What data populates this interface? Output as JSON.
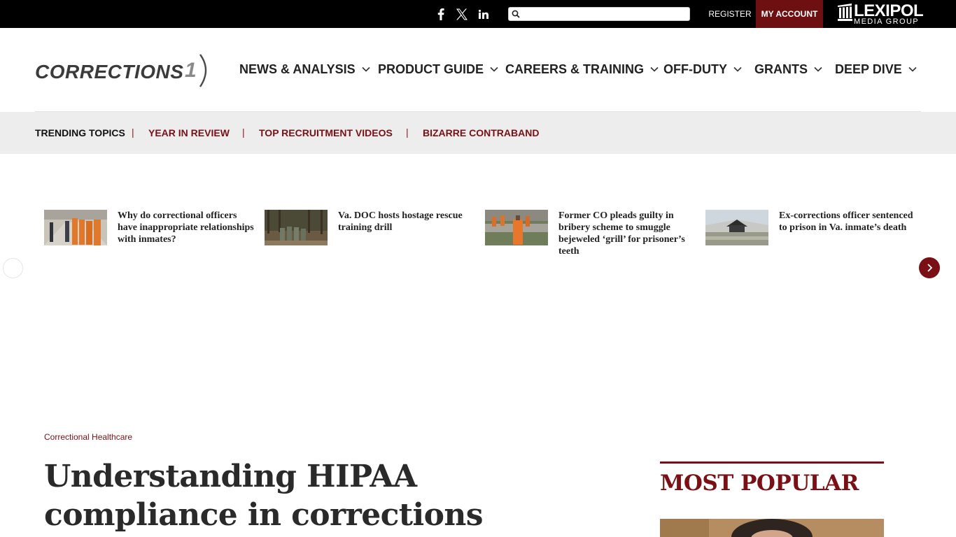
{
  "topbar": {
    "social": [
      {
        "icon": "facebook-icon"
      },
      {
        "icon": "x-icon"
      },
      {
        "icon": "linkedin-icon"
      }
    ],
    "search": {
      "placeholder": "",
      "value": ""
    },
    "register_label": "REGISTER",
    "my_account_label": "MY ACCOUNT",
    "brand": {
      "name": "LEXIPOL",
      "sub": "MEDIA GROUP"
    }
  },
  "header": {
    "logo_text": "CORRECTIONS",
    "logo_number": "1",
    "nav": [
      {
        "label": "NEWS & ANALYSIS"
      },
      {
        "label": "PRODUCT GUIDE"
      },
      {
        "label": "CAREERS & TRAINING"
      },
      {
        "label": "OFF-DUTY"
      },
      {
        "label": "GRANTS"
      },
      {
        "label": "DEEP DIVE"
      }
    ]
  },
  "trending": {
    "label": "TRENDING TOPICS",
    "separator": "|",
    "links": [
      {
        "label": "YEAR IN REVIEW"
      },
      {
        "label": "TOP RECRUITMENT VIDEOS"
      },
      {
        "label": "BIZARRE CONTRABAND"
      }
    ]
  },
  "carousel": {
    "items": [
      {
        "title": "Why do correctional officers have inappropriate relationships with inmates?"
      },
      {
        "title": "Va. DOC hosts hostage rescue training drill"
      },
      {
        "title": "Former CO pleads guilty in bribery scheme to smuggle bejeweled ‘grill’ for prisoner’s teeth"
      },
      {
        "title": "Ex-corrections officer sentenced to prison in Va. inmate’s death"
      }
    ]
  },
  "article": {
    "category": "Correctional Healthcare",
    "headline": "Understanding HIPAA compliance in corrections"
  },
  "sidebar": {
    "most_popular_title": "MOST POPULAR"
  },
  "colors": {
    "brand_red": "#7a1015",
    "account_red": "#6e0f12",
    "topbar_bg": "#000000",
    "trending_bg": "#ededed"
  }
}
